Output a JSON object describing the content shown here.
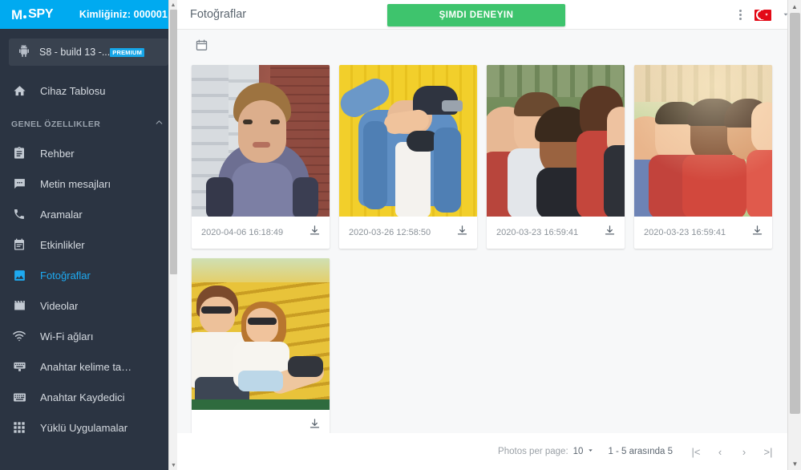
{
  "brand": {
    "logo_m": "M",
    "logo_spy": "SPY",
    "account_id_label": "Kimliğiniz: 000001",
    "accent_color": "#00aaf0"
  },
  "device": {
    "icon": "android-icon",
    "label": "S8 - build 13 -...",
    "badge": "PREMIUM",
    "badge_color": "#16a6e8"
  },
  "sidebar": {
    "dashboard": {
      "label": "Cihaz Tablosu",
      "icon": "home-icon"
    },
    "section": {
      "label": "GENEL ÖZELLIKLER",
      "chevron": "chevron-up-icon"
    },
    "items": [
      {
        "label": "Rehber",
        "icon": "contacts-icon",
        "active": false
      },
      {
        "label": "Metin mesajları",
        "icon": "message-icon",
        "active": false
      },
      {
        "label": "Aramalar",
        "icon": "phone-icon",
        "active": false
      },
      {
        "label": "Etkinlikler",
        "icon": "calendar-icon",
        "active": false
      },
      {
        "label": "Fotoğraflar",
        "icon": "photo-icon",
        "active": true
      },
      {
        "label": "Videolar",
        "icon": "video-icon",
        "active": false
      },
      {
        "label": "Wi-Fi ağları",
        "icon": "wifi-icon",
        "active": false
      },
      {
        "label": "Anahtar kelime ta…",
        "icon": "keyword-icon",
        "active": false
      },
      {
        "label": "Anahtar Kaydedici",
        "icon": "keyboard-icon",
        "active": false
      },
      {
        "label": "Yüklü Uygulamalar",
        "icon": "apps-grid-icon",
        "active": false
      }
    ],
    "active_color": "#1eaaf1"
  },
  "topbar": {
    "title": "Fotoğraflar",
    "cta_label": "ŞIMDI DENEYIN",
    "cta_color": "#3ec46d",
    "kebab": "more-vertical-icon",
    "flag": "turkey-flag-icon",
    "lang_chevron": "chevron-down-icon"
  },
  "filterbar": {
    "calendar_icon": "calendar-icon"
  },
  "photos": [
    {
      "date": "2020-04-06 16:18:49",
      "download_icon": "download-icon",
      "art": "portrait-brick"
    },
    {
      "date": "2020-03-26 12:58:50",
      "download_icon": "download-icon",
      "art": "yellow-denim"
    },
    {
      "date": "2020-03-23 16:59:41",
      "download_icon": "download-icon",
      "art": "group-park"
    },
    {
      "date": "2020-03-23 16:59:41",
      "download_icon": "download-icon",
      "art": "group-warm"
    },
    {
      "date": "",
      "download_icon": "download-icon",
      "art": "couple-bench"
    }
  ],
  "paginator": {
    "per_page_label": "Photos per page:",
    "per_page_value": "10",
    "per_page_chevron": "chevron-down-icon",
    "range_label": "1 - 5 arasında 5",
    "first_label": "|<",
    "prev_label": "‹",
    "next_label": "›",
    "last_label": ">|"
  }
}
